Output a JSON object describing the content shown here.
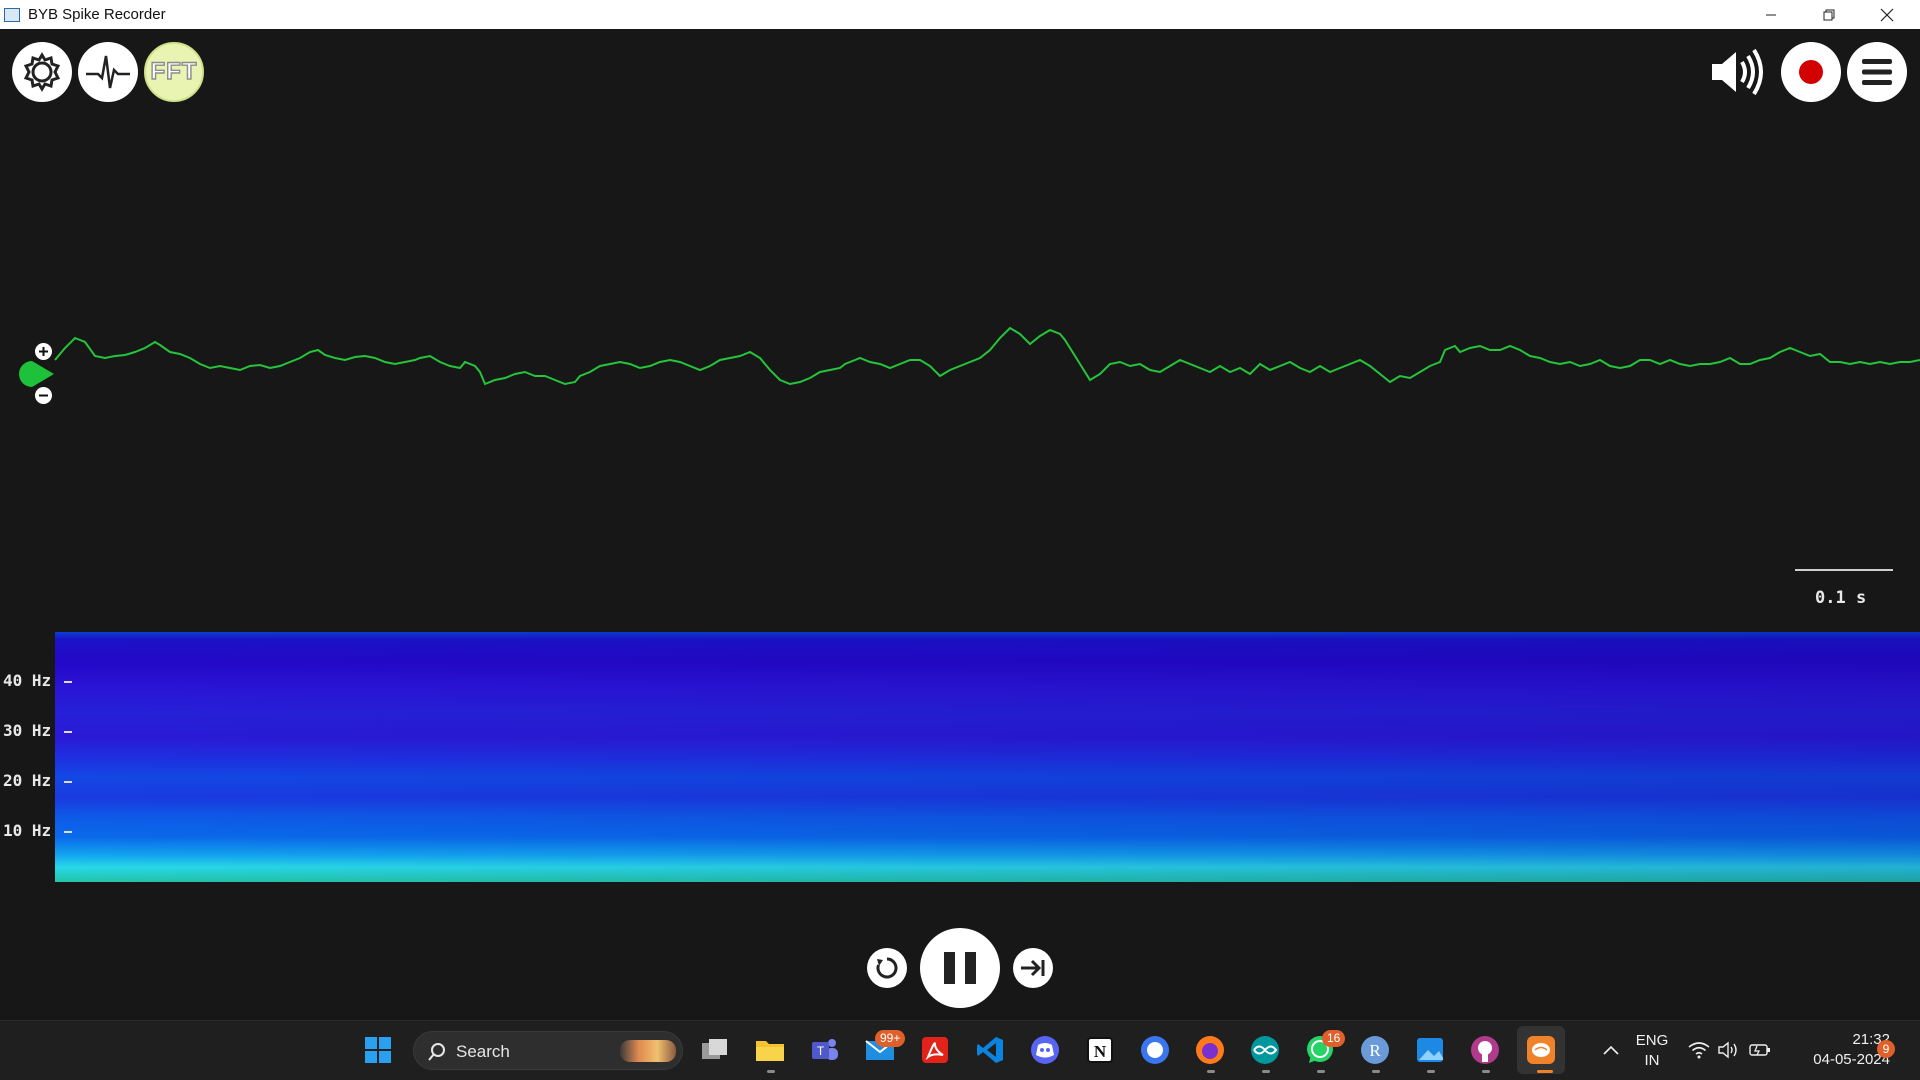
{
  "window": {
    "title": "BYB Spike Recorder"
  },
  "toolbar": {
    "settings_icon": "gear-icon",
    "threshold_icon": "spike-icon",
    "fft_label": "FFT",
    "speaker_icon": "speaker-icon",
    "record_icon": "record-icon",
    "menu_icon": "hamburger-icon"
  },
  "waveform": {
    "color": "#25c43a",
    "channel_color": "#1ec23a"
  },
  "time_scale": {
    "label": "0.1 s"
  },
  "spectrogram": {
    "frequency_labels": [
      "40 Hz",
      "30 Hz",
      "20 Hz",
      "10 Hz"
    ]
  },
  "playback": {
    "rewind_icon": "rewind-icon",
    "pause_icon": "pause-icon",
    "forward_icon": "skip-forward-icon"
  },
  "taskbar": {
    "search_placeholder": "Search",
    "mail_badge": "99+",
    "whatsapp_badge": "16",
    "language_line1": "ENG",
    "language_line2": "IN",
    "time": "21:32",
    "date": "04-05-2024",
    "notification_count": "9"
  },
  "colors": {
    "background": "#171717",
    "record": "#d20000",
    "waveform": "#25c43a",
    "taskbar": "#1f1f1f"
  }
}
